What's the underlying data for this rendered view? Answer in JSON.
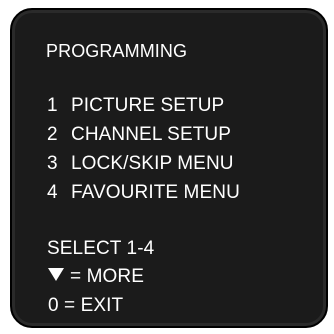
{
  "menu": {
    "title": "PROGRAMMING",
    "items": [
      {
        "number": "1",
        "label": "PICTURE SETUP"
      },
      {
        "number": "2",
        "label": "CHANNEL SETUP"
      },
      {
        "number": "3",
        "label": "LOCK/SKIP MENU"
      },
      {
        "number": "4",
        "label": "FAVOURITE MENU"
      }
    ],
    "prompt": "SELECT 1-4",
    "more_label": "= MORE",
    "more_icon": "down-triangle-icon",
    "exit_label": "0 = EXIT"
  },
  "colors": {
    "panel_background": "#1b1b1b",
    "text": "#ffffff",
    "page_background": "#ffffff"
  }
}
